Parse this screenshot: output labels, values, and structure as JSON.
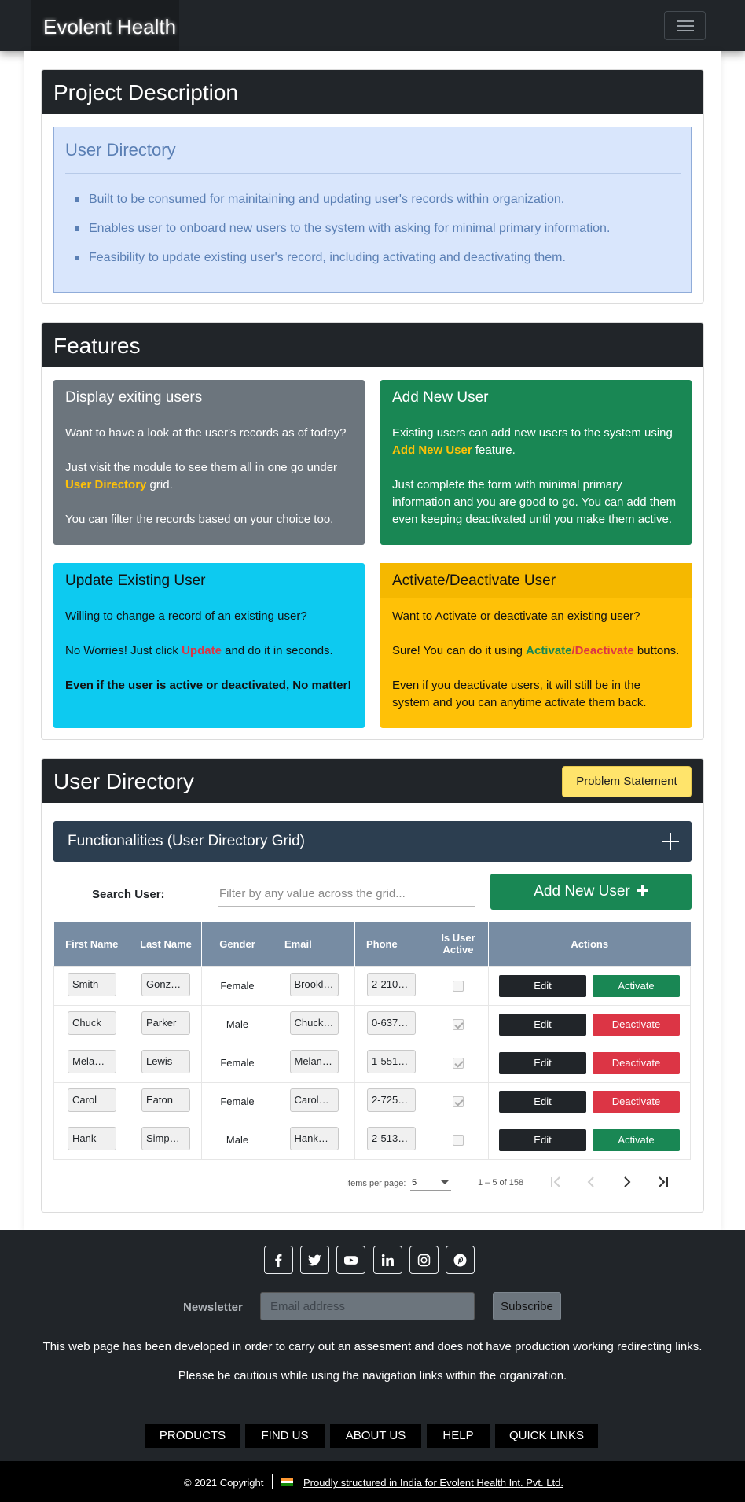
{
  "navbar": {
    "brand": "Evolent Health"
  },
  "project": {
    "heading": "Project Description",
    "box_title": "User Directory",
    "bullets": [
      "Built to be consumed for mainitaining and updating user's records within organization.",
      "Enables user to onboard new users to the system with asking for minimal primary information.",
      "Feasibility to update existing user's record, including activating and deactivating them."
    ]
  },
  "features": {
    "heading": "Features",
    "display": {
      "title": "Display exiting users",
      "p1": "Want to have a look at the user's records as of today?",
      "p2_pre": "Just visit the module to see them all in one go under ",
      "p2_hl": "User Directory",
      "p2_post": " grid.",
      "p3": "You can filter the records based on your choice too."
    },
    "add": {
      "title": "Add New User",
      "p1_pre": "Existing users can add new users to the system using ",
      "p1_hl": "Add New User",
      "p1_post": " feature.",
      "p2": "Just complete the form with minimal primary information and you are good to go. You can add them even keeping deactivated until you make them active."
    },
    "update": {
      "title": "Update Existing User",
      "p1": "Willing to change a record of an existing user?",
      "p2_pre": "No Worries! Just click ",
      "p2_hl": "Update",
      "p2_post": " and do it in seconds.",
      "p3": "Even if the user is active or deactivated, No matter!"
    },
    "activate": {
      "title": "Activate/Deactivate User",
      "p1": "Want to Activate or deactivate an existing user?",
      "p2_pre": "Sure! You can do it using ",
      "p2_hl1": "Activate",
      "p2_sep": "/",
      "p2_hl2": "Deactivate",
      "p2_post": " buttons.",
      "p3": "Even if you deactivate users, it will still be in the system and you can anytime activate them back."
    }
  },
  "directory": {
    "heading": "User Directory",
    "problem_button": "Problem Statement",
    "func_bar": "Functionalities (User Directory Grid)",
    "search_label": "Search User:",
    "search_placeholder": "Filter by any value across the grid...",
    "add_button": "Add New User",
    "columns": [
      "First Name",
      "Last Name",
      "Gender",
      "Email",
      "Phone",
      "Is User Active",
      "Actions"
    ],
    "rows": [
      {
        "first": "Smith",
        "last": "Gonz…",
        "gender": "Female",
        "email": "Brookly…",
        "phone": "2-210…",
        "active": false,
        "edit": "Edit",
        "action": "Activate"
      },
      {
        "first": "Chuck",
        "last": "Parker",
        "gender": "Male",
        "email": "Chuck_…",
        "phone": "0-637…",
        "active": true,
        "edit": "Edit",
        "action": "Deactivate"
      },
      {
        "first": "Mela…",
        "last": "Lewis",
        "gender": "Female",
        "email": "Melanie…",
        "phone": "1-551…",
        "active": true,
        "edit": "Edit",
        "action": "Deactivate"
      },
      {
        "first": "Carol",
        "last": "Eaton",
        "gender": "Female",
        "email": "Carol_E…",
        "phone": "2-725…",
        "active": true,
        "edit": "Edit",
        "action": "Deactivate"
      },
      {
        "first": "Hank",
        "last": "Simp…",
        "gender": "Male",
        "email": "Hank_S…",
        "phone": "2-513…",
        "active": false,
        "edit": "Edit",
        "action": "Activate"
      }
    ],
    "paginator": {
      "label": "Items per page:",
      "page_size": "5",
      "range": "1 – 5 of 158"
    }
  },
  "footer": {
    "socials": [
      "facebook-icon",
      "twitter-icon",
      "youtube-icon",
      "linkedin-icon",
      "instagram-icon",
      "pinterest-icon"
    ],
    "newsletter_label": "Newsletter",
    "newsletter_placeholder": "Email address",
    "subscribe": "Subscribe",
    "disclaimer1": "This web page has been developed in order to carry out an assesment and does not have production working redirecting links.",
    "disclaimer2": "Please be cautious while using the navigation links within the organization.",
    "links": [
      "PRODUCTS",
      "FIND US",
      "ABOUT US",
      "HELP",
      "QUICK LINKS"
    ],
    "copyright": "© 2021 Copyright",
    "credit": "Proudly structured in India for Evolent Health Int. Pvt. Ltd."
  },
  "colors": {
    "dark": "#212529",
    "success": "#198754",
    "danger": "#dc3545",
    "info": "#0dcaf0",
    "warning": "#ffc107",
    "secondary": "#6c757d"
  }
}
